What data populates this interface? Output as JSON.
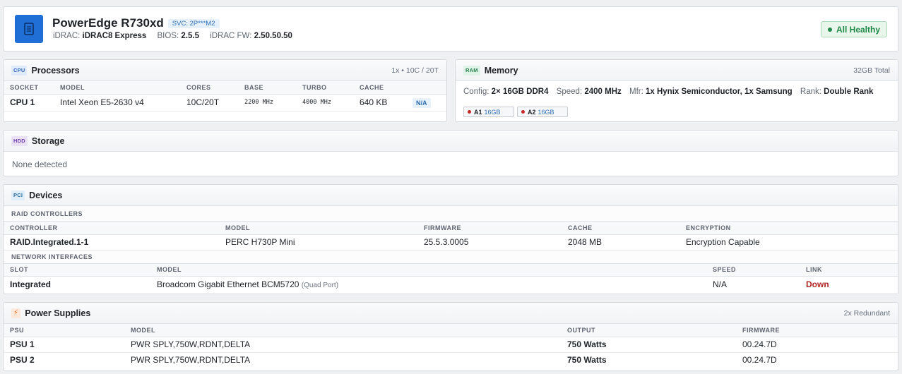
{
  "header": {
    "model": "PowerEdge R730xd",
    "svc": "SVC: 2P***M2",
    "idrac_label": "iDRAC:",
    "idrac_value": "iDRAC8 Express",
    "bios_label": "BIOS:",
    "bios_value": "2.5.5",
    "fw_label": "iDRAC FW:",
    "fw_value": "2.50.50.50",
    "status": "All Healthy",
    "status_color": "#1f8a47"
  },
  "processors": {
    "icon": "CPU",
    "title": "Processors",
    "meta": "1x • 10C / 20T",
    "columns": [
      "SOCKET",
      "MODEL",
      "CORES",
      "BASE",
      "TURBO",
      "CACHE",
      ""
    ],
    "rows": [
      {
        "socket": "CPU 1",
        "model": "Intel Xeon E5-2630 v4",
        "cores": "10C/20T",
        "base": "2200 MHz",
        "turbo": "4000 MHz",
        "cache": "640 KB",
        "status": "N/A"
      }
    ]
  },
  "memory": {
    "icon": "RAM",
    "title": "Memory",
    "meta": "32GB Total",
    "config_label": "Config:",
    "config_value": "2× 16GB DDR4",
    "speed_label": "Speed:",
    "speed_value": "2400 MHz",
    "mfr_label": "Mfr:",
    "mfr_value": "1x Hynix Semiconductor, 1x Samsung",
    "rank_label": "Rank:",
    "rank_value": "Double Rank",
    "slots": [
      {
        "slot": "A1",
        "size": "16GB"
      },
      {
        "slot": "A2",
        "size": "16GB"
      }
    ]
  },
  "storage": {
    "icon": "HDD",
    "title": "Storage",
    "empty": "None detected"
  },
  "devices": {
    "icon": "PCI",
    "title": "Devices",
    "raid_section": "RAID CONTROLLERS",
    "raid_columns": [
      "CONTROLLER",
      "MODEL",
      "FIRMWARE",
      "CACHE",
      "ENCRYPTION"
    ],
    "raid_rows": [
      {
        "controller": "RAID.Integrated.1-1",
        "model": "PERC H730P Mini",
        "firmware": "25.5.3.0005",
        "cache": "2048 MB",
        "encryption": "Encryption Capable"
      }
    ],
    "nic_section": "NETWORK INTERFACES",
    "nic_columns": [
      "SLOT",
      "MODEL",
      "SPEED",
      "LINK"
    ],
    "nic_rows": [
      {
        "slot": "Integrated",
        "model": "Broadcom Gigabit Ethernet BCM5720",
        "note": "(Quad Port)",
        "speed": "N/A",
        "link": "Down"
      }
    ]
  },
  "power": {
    "icon": "⚡",
    "title": "Power Supplies",
    "meta": "2x Redundant",
    "columns": [
      "PSU",
      "MODEL",
      "OUTPUT",
      "FIRMWARE"
    ],
    "rows": [
      {
        "psu": "PSU 1",
        "model": "PWR SPLY,750W,RDNT,DELTA",
        "output": "750 Watts",
        "firmware": "00.24.7D"
      },
      {
        "psu": "PSU 2",
        "model": "PWR SPLY,750W,RDNT,DELTA",
        "output": "750 Watts",
        "firmware": "00.24.7D"
      }
    ]
  }
}
